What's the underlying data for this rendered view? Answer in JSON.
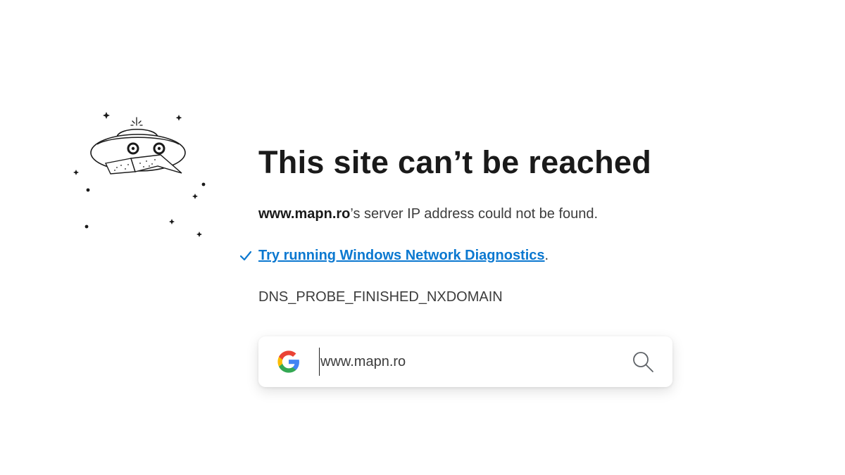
{
  "error": {
    "title": "This site can’t be reached",
    "host": "www.mapn.ro",
    "message_suffix": "’s server IP address could not be found.",
    "suggestion_link": "Try running Windows Network Diagnostics",
    "suggestion_suffix": ".",
    "code": "DNS_PROBE_FINISHED_NXDOMAIN"
  },
  "search": {
    "value": "www.mapn.ro",
    "provider_icon": "google-g-icon",
    "button_icon": "search-icon"
  },
  "colors": {
    "link": "#0b78d0",
    "title": "#1a1a1a",
    "text": "#3c3c3c"
  },
  "illustration": {
    "icon": "ufo-icon"
  }
}
